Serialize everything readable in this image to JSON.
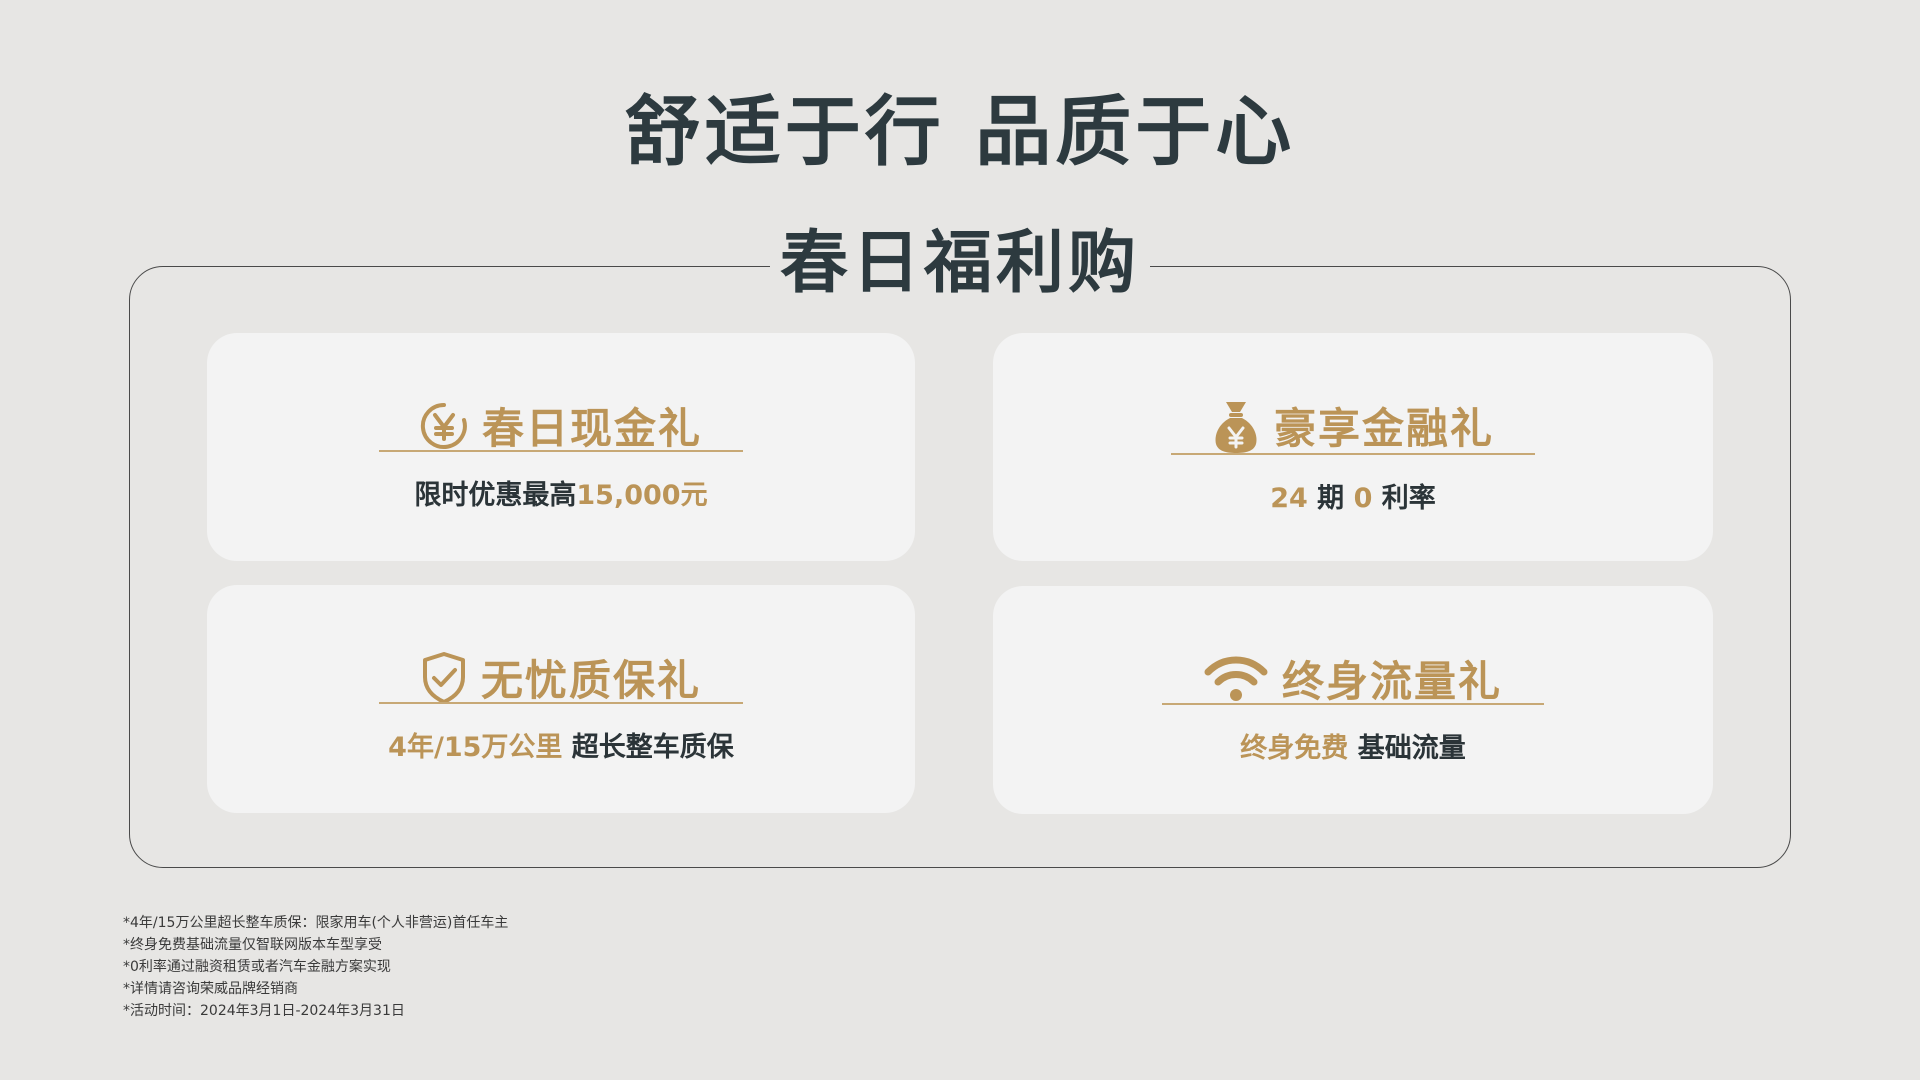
{
  "headline": "舒适于行 品质于心",
  "section_title": "春日福利购",
  "cards": {
    "cash": {
      "title": "春日现金礼",
      "icon": "yen-coin-icon",
      "desc_prefix": "限时优惠最高",
      "desc_highlight": "15,000元"
    },
    "finance": {
      "title": "豪享金融礼",
      "icon": "money-bag-icon",
      "desc_num1": "24",
      "desc_text1": " 期 ",
      "desc_num2": "0",
      "desc_text2": " 利率"
    },
    "warranty": {
      "title": "无忧质保礼",
      "icon": "shield-check-icon",
      "desc_highlight": "4年/15万公里",
      "desc_text": " 超长整车质保"
    },
    "data": {
      "title": "终身流量礼",
      "icon": "wifi-icon",
      "desc_highlight": "终身免费",
      "desc_text": " 基础流量"
    }
  },
  "footnotes": [
    "*4年/15万公里超长整车质保：限家用车(个人非营运)首任车主",
    "*终身免费基础流量仅智联网版本车型享受",
    "*0利率通过融资租赁或者汽车金融方案实现",
    "*详情请咨询荣威品牌经销商",
    "*活动时间：2024年3月1日-2024年3月31日"
  ],
  "colors": {
    "accent_gold": "#bb9457",
    "text_dark": "#2d3a3f",
    "background": "#e7e6e4",
    "card_bg": "#f3f3f3"
  }
}
